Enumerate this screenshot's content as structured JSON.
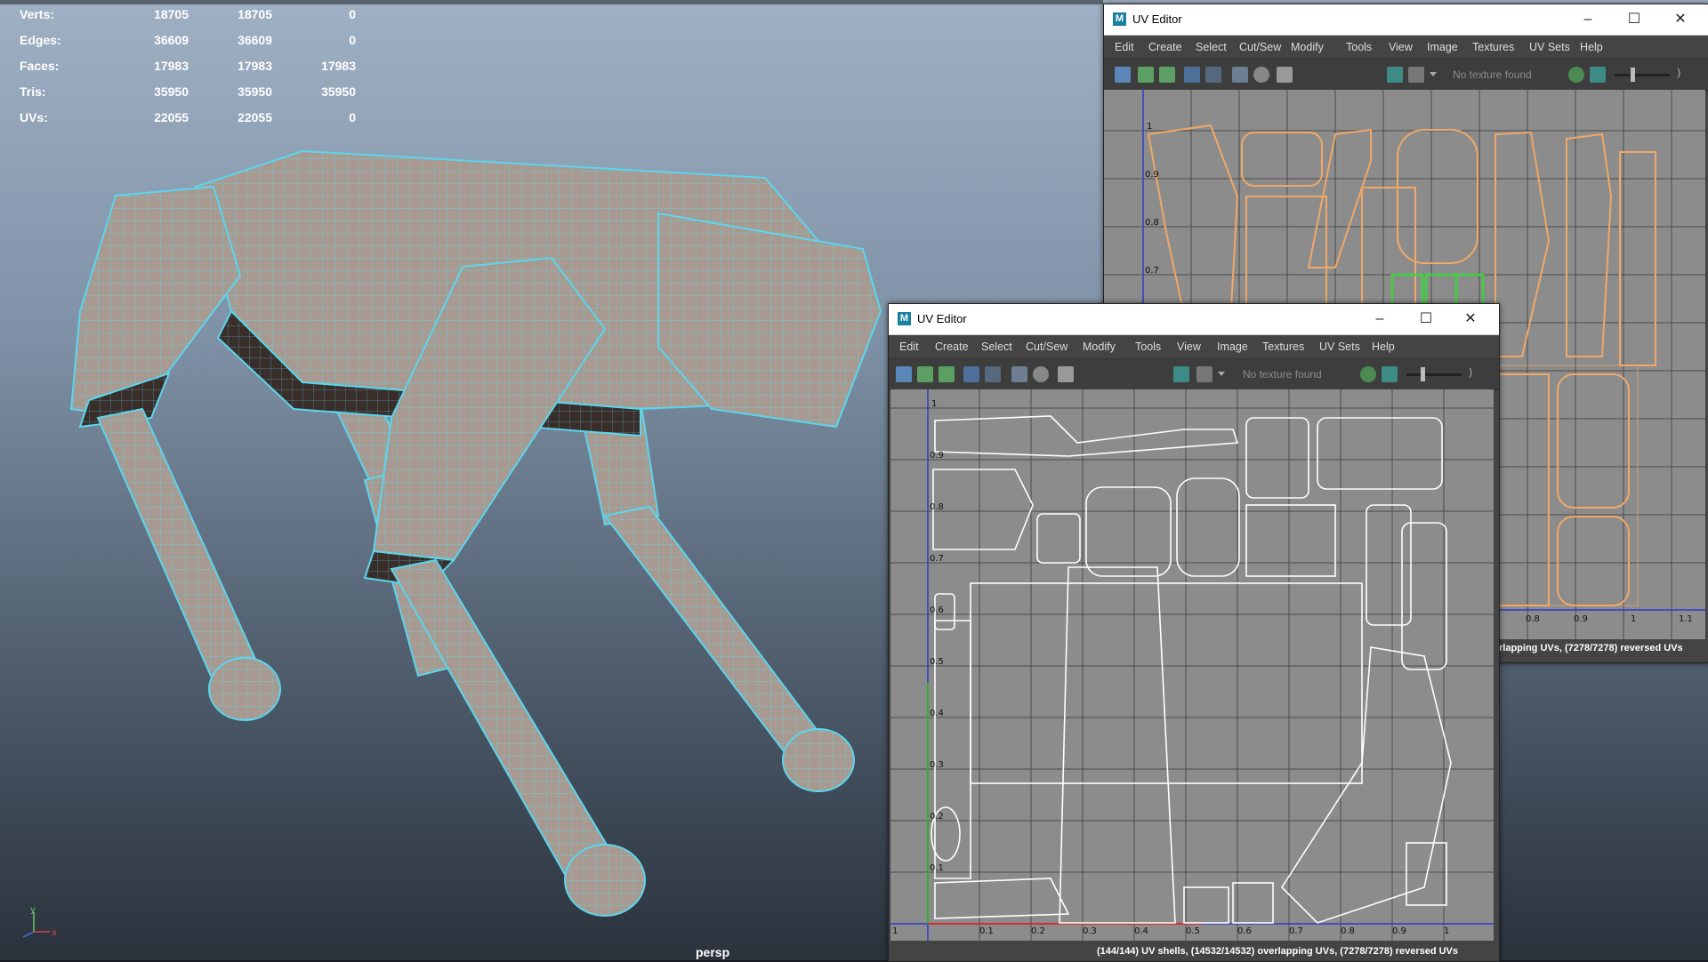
{
  "hud": {
    "rows": [
      {
        "label": "Verts:",
        "v1": "18705",
        "v2": "18705",
        "v3": "0"
      },
      {
        "label": "Edges:",
        "v1": "36609",
        "v2": "36609",
        "v3": "0"
      },
      {
        "label": "Faces:",
        "v1": "17983",
        "v2": "17983",
        "v3": "17983"
      },
      {
        "label": "Tris:",
        "v1": "35950",
        "v2": "35950",
        "v3": "35950"
      },
      {
        "label": "UVs:",
        "v1": "22055",
        "v2": "22055",
        "v3": "0"
      }
    ]
  },
  "viewport": {
    "camera_label": "persp",
    "axis_y": "y",
    "axis_x": "x"
  },
  "back_editor": {
    "title": "UV Editor",
    "menus": [
      "Edit",
      "Create",
      "Select",
      "Cut/Sew",
      "Modify",
      "Tools",
      "View",
      "Image",
      "Textures",
      "UV Sets",
      "Help"
    ],
    "texture_status": "No texture found",
    "axis_labels": [
      "1",
      "0.9",
      "0.8",
      "0.7"
    ],
    "bottom_labels": [
      "0.8",
      "0.9",
      "1",
      "1.1"
    ],
    "status": "rlapping UVs, (7278/7278) reversed UVs"
  },
  "front_editor": {
    "title": "UV Editor",
    "menus": [
      "Edit",
      "Create",
      "Select",
      "Cut/Sew",
      "Modify",
      "Tools",
      "View",
      "Image",
      "Textures",
      "UV Sets",
      "Help"
    ],
    "texture_status": "No texture found",
    "v_labels": [
      "1",
      "0.9",
      "0.8",
      "0.7",
      "0.6",
      "0.5",
      "0.4",
      "0.3",
      "0.2",
      "0.1"
    ],
    "u_labels": [
      "1",
      "0.1",
      "0.2",
      "0.3",
      "0.4",
      "0.5",
      "0.6",
      "0.7",
      "0.8",
      "0.9",
      "1"
    ],
    "status": "(144/144) UV shells, (14532/14532) overlapping UVs, (7278/7278) reversed UVs"
  },
  "colors": {
    "wire": "#5ad6ee",
    "mesh": "#a89a90",
    "uv_orange": "#f0a868",
    "uv_white": "#ffffff",
    "uv_bg": "#8c8c8c",
    "green_sel": "#3cd43c"
  }
}
